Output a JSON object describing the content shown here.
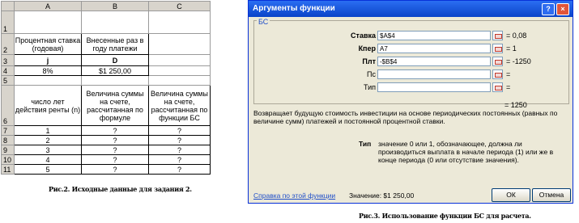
{
  "sheet": {
    "columns": [
      "A",
      "B",
      "C"
    ],
    "row_numbers": [
      "1",
      "2",
      "3",
      "4",
      "5",
      "6",
      "7",
      "8",
      "9",
      "10",
      "11"
    ],
    "header_a": "Процентная ставка (годовая)",
    "header_b": "Внесенные раз в году платежи",
    "sym_a": "j",
    "sym_b": "D",
    "rate": "8%",
    "payment": "$1 250,00",
    "col6_a": "число лет действия ренты (n)",
    "col6_b": "Величина суммы на счете, рассчитанная по формуле",
    "col6_c": "Величина суммы на счете, рассчитанная по функции БС",
    "years": [
      "1",
      "2",
      "3",
      "4",
      "5"
    ],
    "unknown": "?"
  },
  "caption_left": "Рис.2. Исходные данные для задания 2.",
  "caption_right": "Рис.3. Использование функции БС для расчета.",
  "dialog": {
    "title": "Аргументы функции",
    "help": "?",
    "close": "×",
    "function": "БС",
    "args": [
      {
        "label": "Ставка",
        "value": "$A$4",
        "result": "= 0,08"
      },
      {
        "label": "Кпер",
        "value": "A7",
        "result": "= 1"
      },
      {
        "label": "Плт",
        "value": "-$B$4",
        "result": "= -1250"
      },
      {
        "label": "Пс",
        "value": "",
        "result": "="
      },
      {
        "label": "Тип",
        "value": "",
        "result": "="
      }
    ],
    "total": "= 1250",
    "description": "Возвращает будущую стоимость инвестиции на основе периодических постоянных (равных по величине сумм) платежей и постоянной процентной ставки.",
    "tip_label": "Тип",
    "tip_text": "значение 0 или 1, обозначающее, должна ли производиться выплата в начале периода (1) или же в конце периода (0 или отсутствие значения).",
    "help_link": "Справка по этой функции",
    "value_label": "Значение: $1 250,00",
    "ok": "ОК",
    "cancel": "Отмена"
  }
}
